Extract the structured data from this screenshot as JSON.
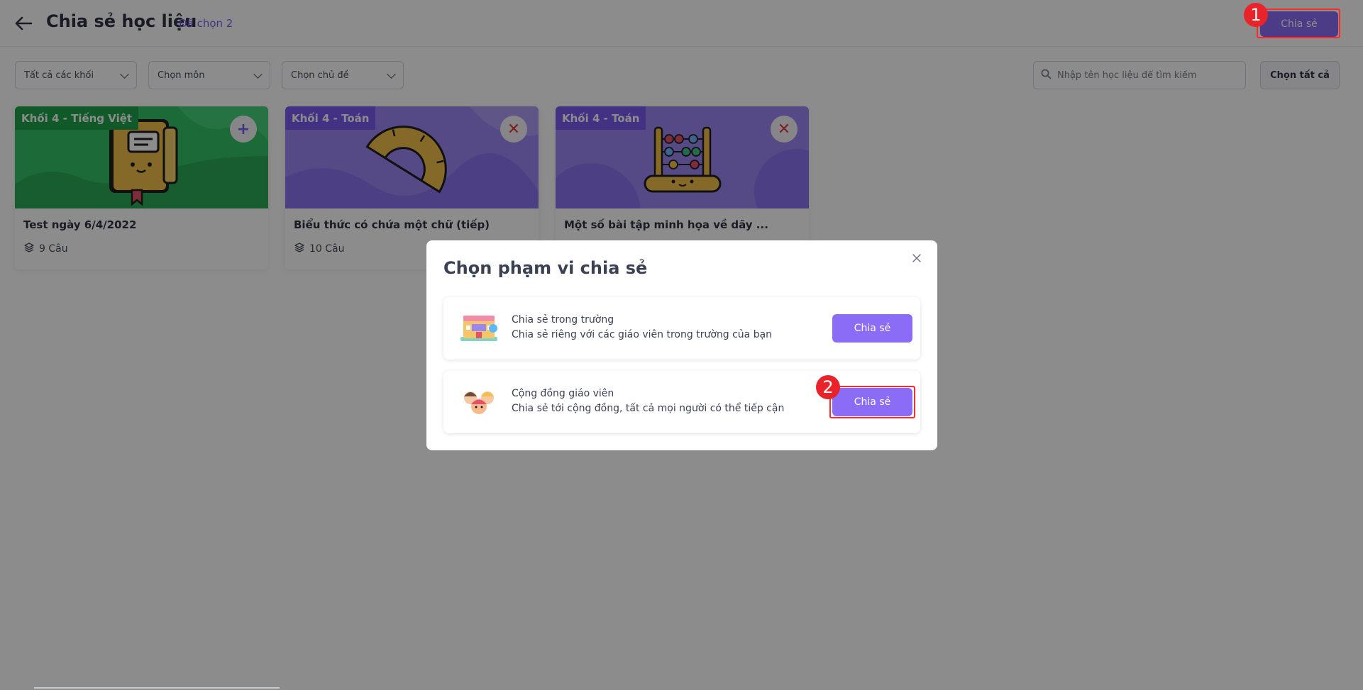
{
  "header": {
    "title": "Chia sẻ học liệu",
    "selected": "Đã chọn 2",
    "share_label": "Chia sẻ"
  },
  "filters": {
    "grade": "Tất cả các khối",
    "subject": "Chọn môn",
    "topic": "Chọn chủ đề",
    "search_placeholder": "Nhập tên học liệu để tìm kiếm",
    "select_all": "Chọn tất cả"
  },
  "cards": [
    {
      "tag": "Khối 4 - Tiếng Việt",
      "title": "Test ngày 6/4/2022",
      "count": "9 Câu",
      "action": "+"
    },
    {
      "tag": "Khối 4 - Toán",
      "title": "Biểu thức có chứa một chữ (tiếp)",
      "count": "10 Câu",
      "action": "✕"
    },
    {
      "tag": "Khối 4 - Toán",
      "title": "Một số bài tập minh họa về dãy ...",
      "count": "",
      "action": "✕"
    }
  ],
  "modal": {
    "title": "Chọn phạm vi chia sẻ",
    "options": [
      {
        "title": "Chia sẻ trong trường",
        "desc": "Chia sẻ riêng với các giáo viên trong trường của bạn",
        "button": "Chia sẻ"
      },
      {
        "title": "Cộng đồng giáo viên",
        "desc": "Chia sẻ tới cộng đồng, tất cả mọi người có thể tiếp cận",
        "button": "Chia sẻ"
      }
    ]
  },
  "markers": [
    "1",
    "2"
  ],
  "colors": {
    "accent": "#8b6cf6",
    "tag_green": "#1fa34a",
    "tag_purple": "#7a5cf0",
    "highlight": "#ff2b2b",
    "marker": "#e8232a"
  }
}
